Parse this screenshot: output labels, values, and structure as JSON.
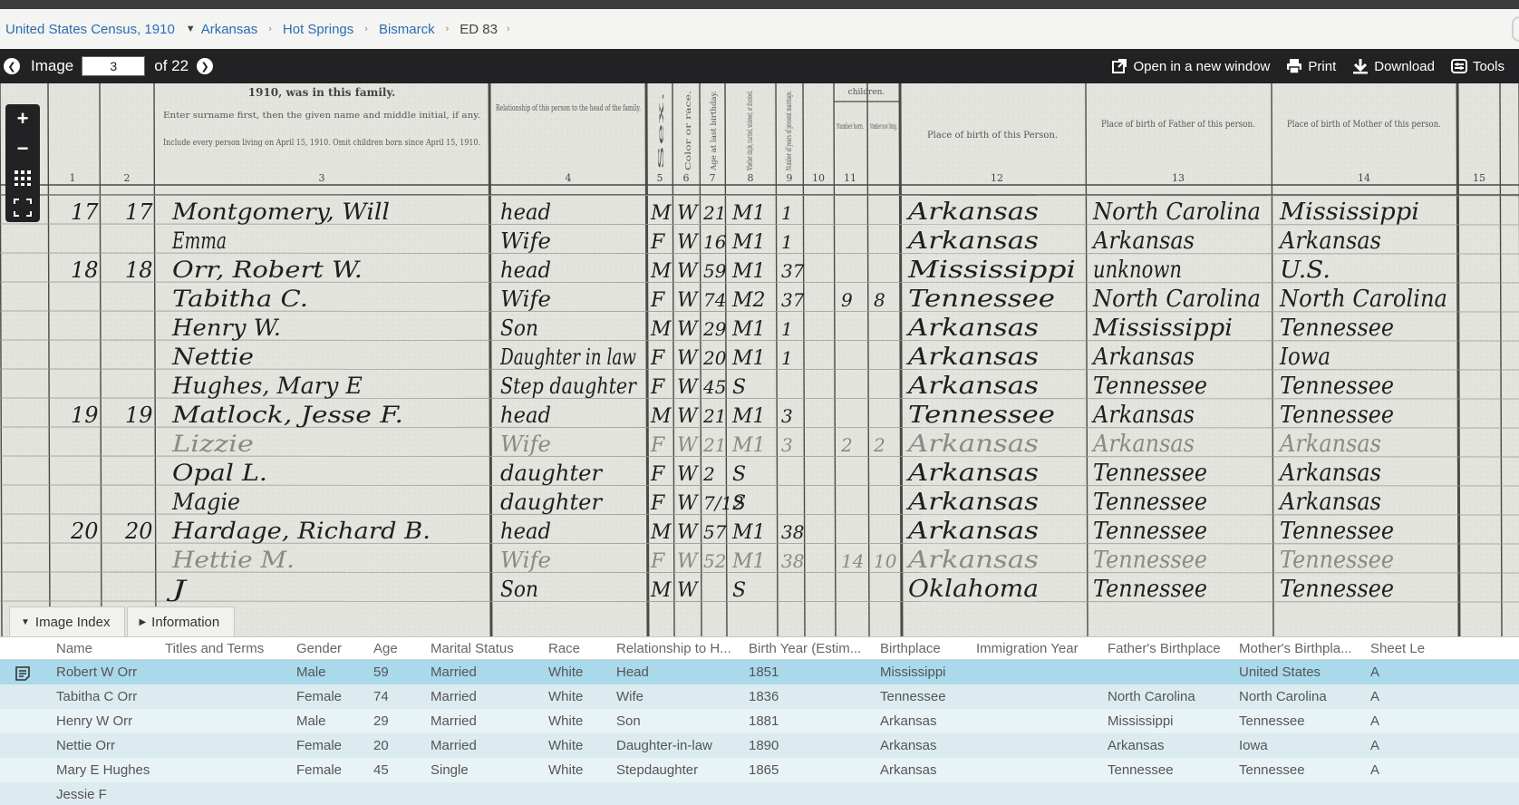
{
  "breadcrumb": {
    "collection": "United States Census, 1910",
    "state": "Arkansas",
    "county": "Hot Springs",
    "township": "Bismarck",
    "district": "ED 83"
  },
  "toolbar": {
    "image_label": "Image",
    "image_number": "3",
    "of_label": "of 22",
    "open_window": "Open in a new window",
    "print": "Print",
    "download": "Download",
    "tools": "Tools"
  },
  "zoom": {
    "zoom_in": "+",
    "zoom_out": "−"
  },
  "panel_tabs": {
    "image_index": "Image Index",
    "information": "Information"
  },
  "index": {
    "columns": [
      "Name",
      "Titles and Terms",
      "Gender",
      "Age",
      "Marital Status",
      "Race",
      "Relationship to H...",
      "Birth Year (Estim...",
      "Birthplace",
      "Immigration Year",
      "Father's Birthplace",
      "Mother's Birthpla...",
      "Sheet Le"
    ],
    "rows": [
      {
        "name": "Robert W Orr",
        "titles": "",
        "gender": "Male",
        "age": "59",
        "marital": "Married",
        "race": "White",
        "relationship": "Head",
        "birth_year": "1851",
        "birthplace": "Mississippi",
        "immigration": "",
        "father_bp": "",
        "mother_bp": "United States",
        "sheet": "A"
      },
      {
        "name": "Tabitha C Orr",
        "titles": "",
        "gender": "Female",
        "age": "74",
        "marital": "Married",
        "race": "White",
        "relationship": "Wife",
        "birth_year": "1836",
        "birthplace": "Tennessee",
        "immigration": "",
        "father_bp": "North Carolina",
        "mother_bp": "North Carolina",
        "sheet": "A"
      },
      {
        "name": "Henry W Orr",
        "titles": "",
        "gender": "Male",
        "age": "29",
        "marital": "Married",
        "race": "White",
        "relationship": "Son",
        "birth_year": "1881",
        "birthplace": "Arkansas",
        "immigration": "",
        "father_bp": "Mississippi",
        "mother_bp": "Tennessee",
        "sheet": "A"
      },
      {
        "name": "Nettie Orr",
        "titles": "",
        "gender": "Female",
        "age": "20",
        "marital": "Married",
        "race": "White",
        "relationship": "Daughter-in-law",
        "birth_year": "1890",
        "birthplace": "Arkansas",
        "immigration": "",
        "father_bp": "Arkansas",
        "mother_bp": "Iowa",
        "sheet": "A"
      },
      {
        "name": "Mary E Hughes",
        "titles": "",
        "gender": "Female",
        "age": "45",
        "marital": "Single",
        "race": "White",
        "relationship": "Stepdaughter",
        "birth_year": "1865",
        "birthplace": "Arkansas",
        "immigration": "",
        "father_bp": "Tennessee",
        "mother_bp": "Tennessee",
        "sheet": "A"
      },
      {
        "name": "Jessie F",
        "titles": "",
        "gender": "",
        "age": "",
        "marital": "",
        "race": "",
        "relationship": "",
        "birth_year": "",
        "birthplace": "",
        "immigration": "",
        "father_bp": "",
        "mother_bp": "",
        "sheet": ""
      }
    ]
  },
  "census_image": {
    "header_year_text": "1910, was in this family.",
    "header_name_text": "Enter surname first, then the given name and middle initial, if any.",
    "header_include_text": "Include every person living on April 15, 1910. Omit children born since April 15, 1910.",
    "header_relationship": "Relationship of this person to the head of the family.",
    "header_birth_person": "Place of birth of this Person.",
    "header_birth_father": "Place of birth of Father of this person.",
    "header_birth_mother": "Place of birth of Mother of this person.",
    "header_sex": "Sex.",
    "header_color": "Color or race.",
    "header_age": "Age at last birthday.",
    "header_marital": "Whether single, married, widowed, or divorced.",
    "header_years_married": "Number of years of present marriage.",
    "header_children": "children.",
    "header_num_born": "Number born.",
    "header_num_living": "Number now living.",
    "col_numbers": [
      "1",
      "2",
      "3",
      "4",
      "5",
      "6",
      "7",
      "8",
      "9",
      "10",
      "11",
      "12",
      "13",
      "14",
      "15"
    ],
    "rows": [
      {
        "dw": "17",
        "fam": "17",
        "name": "Montgomery, Will",
        "rel": "head",
        "sex": "M",
        "race": "W",
        "age": "21",
        "ms": "M1",
        "ym": "1",
        "born": "",
        "living": "",
        "bp": "Arkansas",
        "fbp": "North Carolina",
        "mbp": "Mississippi"
      },
      {
        "dw": "",
        "fam": "",
        "name": "Emma",
        "rel": "Wife",
        "sex": "F",
        "race": "W",
        "age": "16",
        "ms": "M1",
        "ym": "1",
        "born": "",
        "living": "",
        "bp": "Arkansas",
        "fbp": "Arkansas",
        "mbp": "Arkansas"
      },
      {
        "dw": "18",
        "fam": "18",
        "name": "Orr, Robert W.",
        "rel": "head",
        "sex": "M",
        "race": "W",
        "age": "59",
        "ms": "M1",
        "ym": "37",
        "born": "",
        "living": "",
        "bp": "Mississippi",
        "fbp": "unknown",
        "mbp": "U.S."
      },
      {
        "dw": "",
        "fam": "",
        "name": "Tabitha C.",
        "rel": "Wife",
        "sex": "F",
        "race": "W",
        "age": "74",
        "ms": "M2",
        "ym": "37",
        "born": "9",
        "living": "8",
        "bp": "Tennessee",
        "fbp": "North Carolina",
        "mbp": "North Carolina"
      },
      {
        "dw": "",
        "fam": "",
        "name": "Henry W.",
        "rel": "Son",
        "sex": "M",
        "race": "W",
        "age": "29",
        "ms": "M1",
        "ym": "1",
        "born": "",
        "living": "",
        "bp": "Arkansas",
        "fbp": "Mississippi",
        "mbp": "Tennessee"
      },
      {
        "dw": "",
        "fam": "",
        "name": "Nettie",
        "rel": "Daughter in law",
        "sex": "F",
        "race": "W",
        "age": "20",
        "ms": "M1",
        "ym": "1",
        "born": "",
        "living": "",
        "bp": "Arkansas",
        "fbp": "Arkansas",
        "mbp": "Iowa"
      },
      {
        "dw": "",
        "fam": "",
        "name": "Hughes, Mary E",
        "rel": "Step daughter",
        "sex": "F",
        "race": "W",
        "age": "45",
        "ms": "S",
        "ym": "",
        "born": "",
        "living": "",
        "bp": "Arkansas",
        "fbp": "Tennessee",
        "mbp": "Tennessee"
      },
      {
        "dw": "19",
        "fam": "19",
        "name": "Matlock, Jesse F.",
        "rel": "head",
        "sex": "M",
        "race": "W",
        "age": "21",
        "ms": "M1",
        "ym": "3",
        "born": "",
        "living": "",
        "bp": "Tennessee",
        "fbp": "Arkansas",
        "mbp": "Tennessee"
      },
      {
        "dw": "",
        "fam": "",
        "name": "Lizzie",
        "rel": "Wife",
        "sex": "F",
        "race": "W",
        "age": "21",
        "ms": "M1",
        "ym": "3",
        "born": "2",
        "living": "2",
        "bp": "Arkansas",
        "fbp": "Arkansas",
        "mbp": "Arkansas"
      },
      {
        "dw": "",
        "fam": "",
        "name": "Opal L.",
        "rel": "daughter",
        "sex": "F",
        "race": "W",
        "age": "2",
        "ms": "S",
        "ym": "",
        "born": "",
        "living": "",
        "bp": "Arkansas",
        "fbp": "Tennessee",
        "mbp": "Arkansas"
      },
      {
        "dw": "",
        "fam": "",
        "name": "Magie",
        "rel": "daughter",
        "sex": "F",
        "race": "W",
        "age": "7/12",
        "ms": "S",
        "ym": "",
        "born": "",
        "living": "",
        "bp": "Arkansas",
        "fbp": "Tennessee",
        "mbp": "Arkansas"
      },
      {
        "dw": "20",
        "fam": "20",
        "name": "Hardage, Richard B.",
        "rel": "head",
        "sex": "M",
        "race": "W",
        "age": "57",
        "ms": "M1",
        "ym": "38",
        "born": "",
        "living": "",
        "bp": "Arkansas",
        "fbp": "Tennessee",
        "mbp": "Tennessee"
      },
      {
        "dw": "",
        "fam": "",
        "name": "Hettie M.",
        "rel": "Wife",
        "sex": "F",
        "race": "W",
        "age": "52",
        "ms": "M1",
        "ym": "38",
        "born": "14",
        "living": "10",
        "bp": "Arkansas",
        "fbp": "Tennessee",
        "mbp": "Tennessee"
      },
      {
        "dw": "",
        "fam": "",
        "name": "J",
        "rel": "Son",
        "sex": "M",
        "race": "W",
        "age": "",
        "ms": "S",
        "ym": "",
        "born": "",
        "living": "",
        "bp": "Oklahoma",
        "fbp": "Tennessee",
        "mbp": "Tennessee"
      }
    ]
  }
}
